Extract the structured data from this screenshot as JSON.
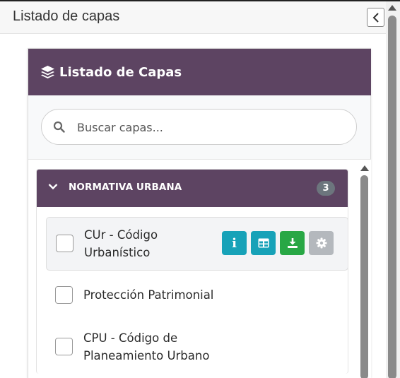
{
  "panel": {
    "title": "Listado de capas",
    "collapse_icon": "chevron-left-icon"
  },
  "card": {
    "title": "Listado de Capas",
    "title_icon": "layers-icon",
    "header_color": "#5d4462"
  },
  "search": {
    "placeholder": "Buscar capas...",
    "value": "",
    "icon": "search-icon"
  },
  "groups": [
    {
      "title": "NORMATIVA URBANA",
      "count": "3",
      "expanded": true,
      "layers": [
        {
          "name": "CUr - Código Urbanístico",
          "checked": false,
          "active": true,
          "actions": [
            "info-icon",
            "table-icon",
            "download-icon",
            "gear-icon"
          ]
        },
        {
          "name": "Protección Patrimonial",
          "checked": false,
          "active": false
        },
        {
          "name": "CPU - Código de Planeamiento Urbano",
          "checked": false,
          "active": false
        }
      ]
    }
  ],
  "colors": {
    "info": "#17a2b8",
    "table": "#17a2b8",
    "download": "#28a745",
    "settings": "#b4b8bd",
    "badge": "#6c757d"
  }
}
